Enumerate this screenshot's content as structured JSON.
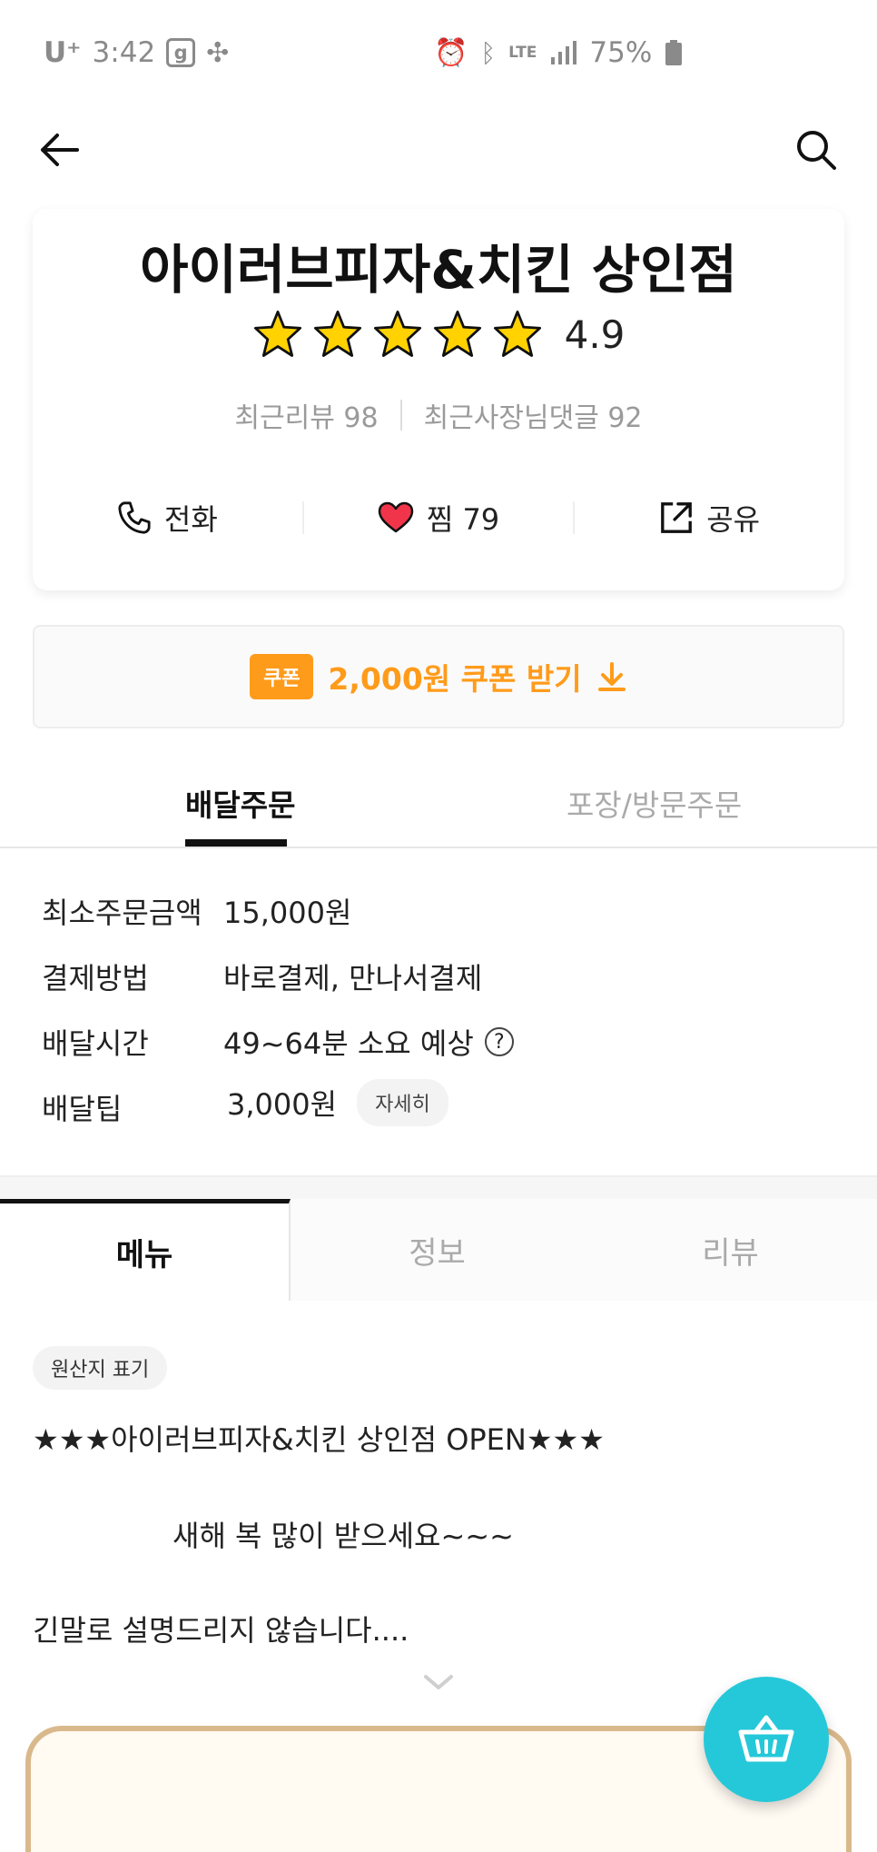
{
  "status_bar": {
    "carrier": "U⁺",
    "time": "3:42",
    "network": "LTE",
    "battery": "75%"
  },
  "store": {
    "name": "아이러브피자&치킨 상인점",
    "rating": "4.9",
    "recent_reviews": "최근리뷰 98",
    "owner_replies": "최근사장님댓글 92"
  },
  "actions": {
    "call": "전화",
    "like": "찜 79",
    "share": "공유"
  },
  "coupon": {
    "badge": "쿠폰",
    "label": "2,000원 쿠폰 받기"
  },
  "order_tabs": {
    "delivery": "배달주문",
    "pickup": "포장/방문주문"
  },
  "info": {
    "rows": [
      {
        "label": "최소주문금액",
        "value": "15,000원"
      },
      {
        "label": "결제방법",
        "value": "바로결제, 만나서결제"
      },
      {
        "label": "배달시간",
        "value": "49~64분 소요 예상"
      },
      {
        "label": "배달팁",
        "value": "3,000원"
      }
    ],
    "detail_button": "자세히",
    "help_glyph": "?"
  },
  "menu_tabs": {
    "menu": "메뉴",
    "info": "정보",
    "review": "리뷰"
  },
  "notice": {
    "origin_chip": "원산지 표기",
    "line1": "★★★아이러브피자&치킨 상인점 OPEN★★★",
    "line2": "새해 복 많이 받으세요~~~",
    "line3": "긴말로 설명드리지 않습니다...."
  },
  "colors": {
    "accent_orange": "#ff9b1a",
    "cart_teal": "#25c8d9",
    "star_yellow": "#ffd200"
  }
}
